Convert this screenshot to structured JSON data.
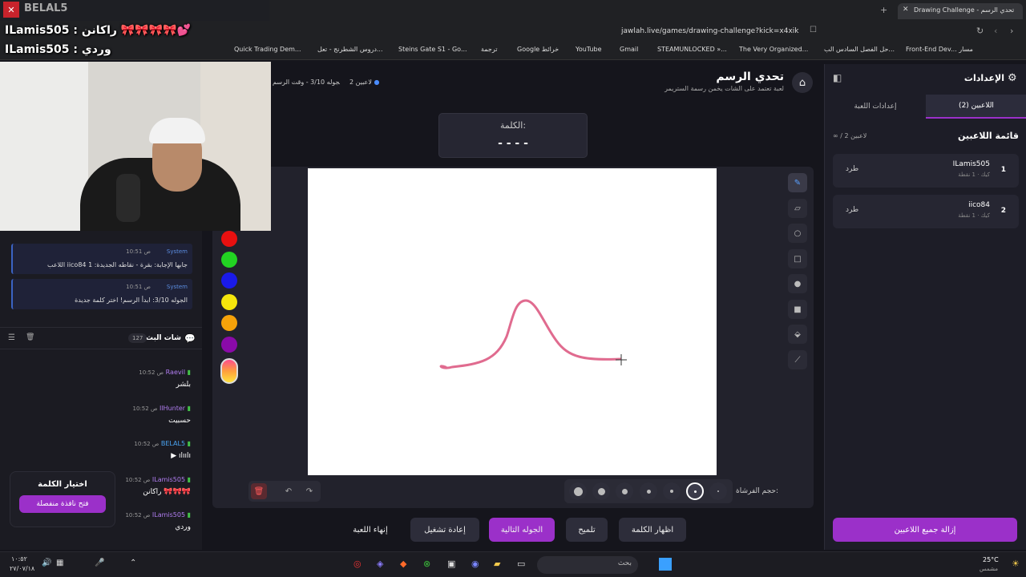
{
  "browser": {
    "tab_title": "Drawing Challenge - تحدي الرسم",
    "url": "jawlah.live/games/drawing-challenge?kick=x4xik",
    "bookmarks": [
      "Quick Trading Dem...",
      "دروس الشطرنج - تعل...",
      "Steins Gate S1 - Go...",
      "ترجمة",
      "Google خرائط",
      "YouTube",
      "Gmail",
      "STEAMUNLOCKED »...",
      "The Very Organized...",
      "حل الفصل السادس الب...",
      "Front-End Dev... مسار"
    ]
  },
  "stream_overlay": {
    "top_name": "BELAL5",
    "line1": "ILamis505 : راكانن 🎀🎀🎀🎀💕",
    "line2": "ILamis505 : وردي"
  },
  "header": {
    "title": "تحدي الرسم",
    "subtitle": "لعبة تعتمد على الشات يخمن رسمة الستريمر",
    "round_info": "الجوله 3/10 - وقت الرسم",
    "players_count": "2 لاعبين"
  },
  "word_box": {
    "label": "الكلمة:",
    "mask": "- - - -"
  },
  "colors": {
    "accent": "#9b30c9",
    "stroke": "#e06b8f",
    "palette": [
      "#e81010",
      "#22d322",
      "#1a1ae8",
      "#f5e60c",
      "#f5a20a",
      "#8a0aa8"
    ]
  },
  "tools": [
    "pencil-icon",
    "eraser-icon",
    "circle-icon",
    "square-icon",
    "filled-circle-icon",
    "filled-square-icon",
    "fill-bucket-icon",
    "line-icon"
  ],
  "brush": {
    "label": "حجم الفرشاة:",
    "sizes": [
      9,
      8,
      7,
      5,
      4,
      3,
      2
    ],
    "selected_index": 5
  },
  "bottom_buttons": {
    "show_word": "اظهار الكلمة",
    "hint": "تلميح",
    "next_round": "الجوله التالية",
    "restart": "إعادة تشغيل",
    "end_game": "إنهاء اللعبة"
  },
  "settings_panel": {
    "title": "الإعدادات",
    "tab_players": "اللاعبين (2)",
    "tab_game": "إعدادات اللعبة",
    "list_title": "قائمة اللاعبين",
    "list_count": "∞ / 2 لاعبين",
    "players": [
      {
        "rank": "1",
        "name": "ILamis505",
        "meta": "كيك · 1 نقطة",
        "kick": "طرد"
      },
      {
        "rank": "2",
        "name": "iico84",
        "meta": "كيك · 1 نقطة",
        "kick": "طرد"
      }
    ],
    "remove_all": "إزالة جميع اللاعبين"
  },
  "chat": {
    "system_messages": [
      {
        "time": "10:51 ص",
        "sender": "System",
        "text": "اللاعب iico84 جابها الإجابة: بقرة - نقاطه الجديدة: 1"
      },
      {
        "time": "10:51 ص",
        "sender": "System",
        "text": "الجوله 3/10: ابدأ الرسم! اختر كلمة جديدة"
      }
    ],
    "title": "شات البث",
    "count": "127",
    "messages": [
      {
        "time": "10:52 ص",
        "user": "Raevil",
        "text": "بلشر",
        "color": "#b07df0"
      },
      {
        "time": "10:52 ص",
        "user": "IlHunter",
        "text": "حسبيت",
        "color": "#b07df0"
      },
      {
        "time": "10:52 ص",
        "user": "BELAL5",
        "text": "▶ ılıılı",
        "color": "#4aa3f0"
      },
      {
        "time": "10:52 ص",
        "user": "ILamis505",
        "text": "راكانن 🎀🎀🎀",
        "color": "#b07df0"
      },
      {
        "time": "10:52 ص",
        "user": "ILamis505",
        "text": "وردي",
        "color": "#b07df0"
      }
    ]
  },
  "choose_word": {
    "title": "اختيار الكلمة",
    "button": "فتح نافذة منفصلة"
  },
  "taskbar": {
    "search_placeholder": "بحث",
    "weather": "25°C",
    "weather_desc": "مشمس",
    "time": "١٠:٥٢",
    "date": "٢٧/٠٧/١٨"
  }
}
